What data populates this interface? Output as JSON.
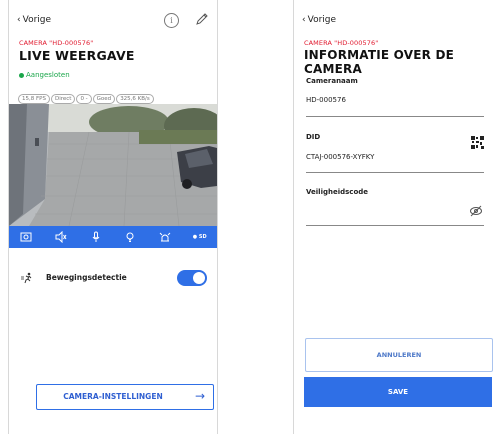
{
  "left_screen": {
    "back_label": "Vorige",
    "camera_id": "CAMERA \"HD-000576\"",
    "title": "LIVE WEERGAVE",
    "status": "Aangesloten",
    "chips": [
      "15,8 FPS",
      "Direct",
      "0 -",
      "Goed",
      "325,6 KB/s"
    ],
    "toolbar": [
      {
        "icon": "snapshot-icon"
      },
      {
        "icon": "mute-speaker-icon"
      },
      {
        "icon": "microphone-icon"
      },
      {
        "icon": "light-bulb-icon"
      },
      {
        "icon": "siren-icon"
      },
      {
        "icon": "sd-quality-icon",
        "label": "SD"
      }
    ],
    "motion_label": "Bewegingsdetectie",
    "motion_enabled": true,
    "settings_button": "CAMERA-INSTELLINGEN"
  },
  "right_screen": {
    "back_label": "Vorige",
    "camera_id": "CAMERA \"HD-000576\"",
    "title": "INFORMATIE OVER DE CAMERA",
    "fields": [
      {
        "label": "Cameranaam",
        "value": "HD-000576"
      },
      {
        "label": "DID",
        "value": "CTAJ-000576-XYFKY"
      },
      {
        "label": "Veiligheidscode",
        "value": ""
      }
    ],
    "cancel_button": "ANNULEREN",
    "save_button": "SAVE"
  },
  "colors": {
    "accent_blue": "#2f6fe6",
    "alert_red": "#e0182d",
    "status_green": "#1aa64a"
  }
}
